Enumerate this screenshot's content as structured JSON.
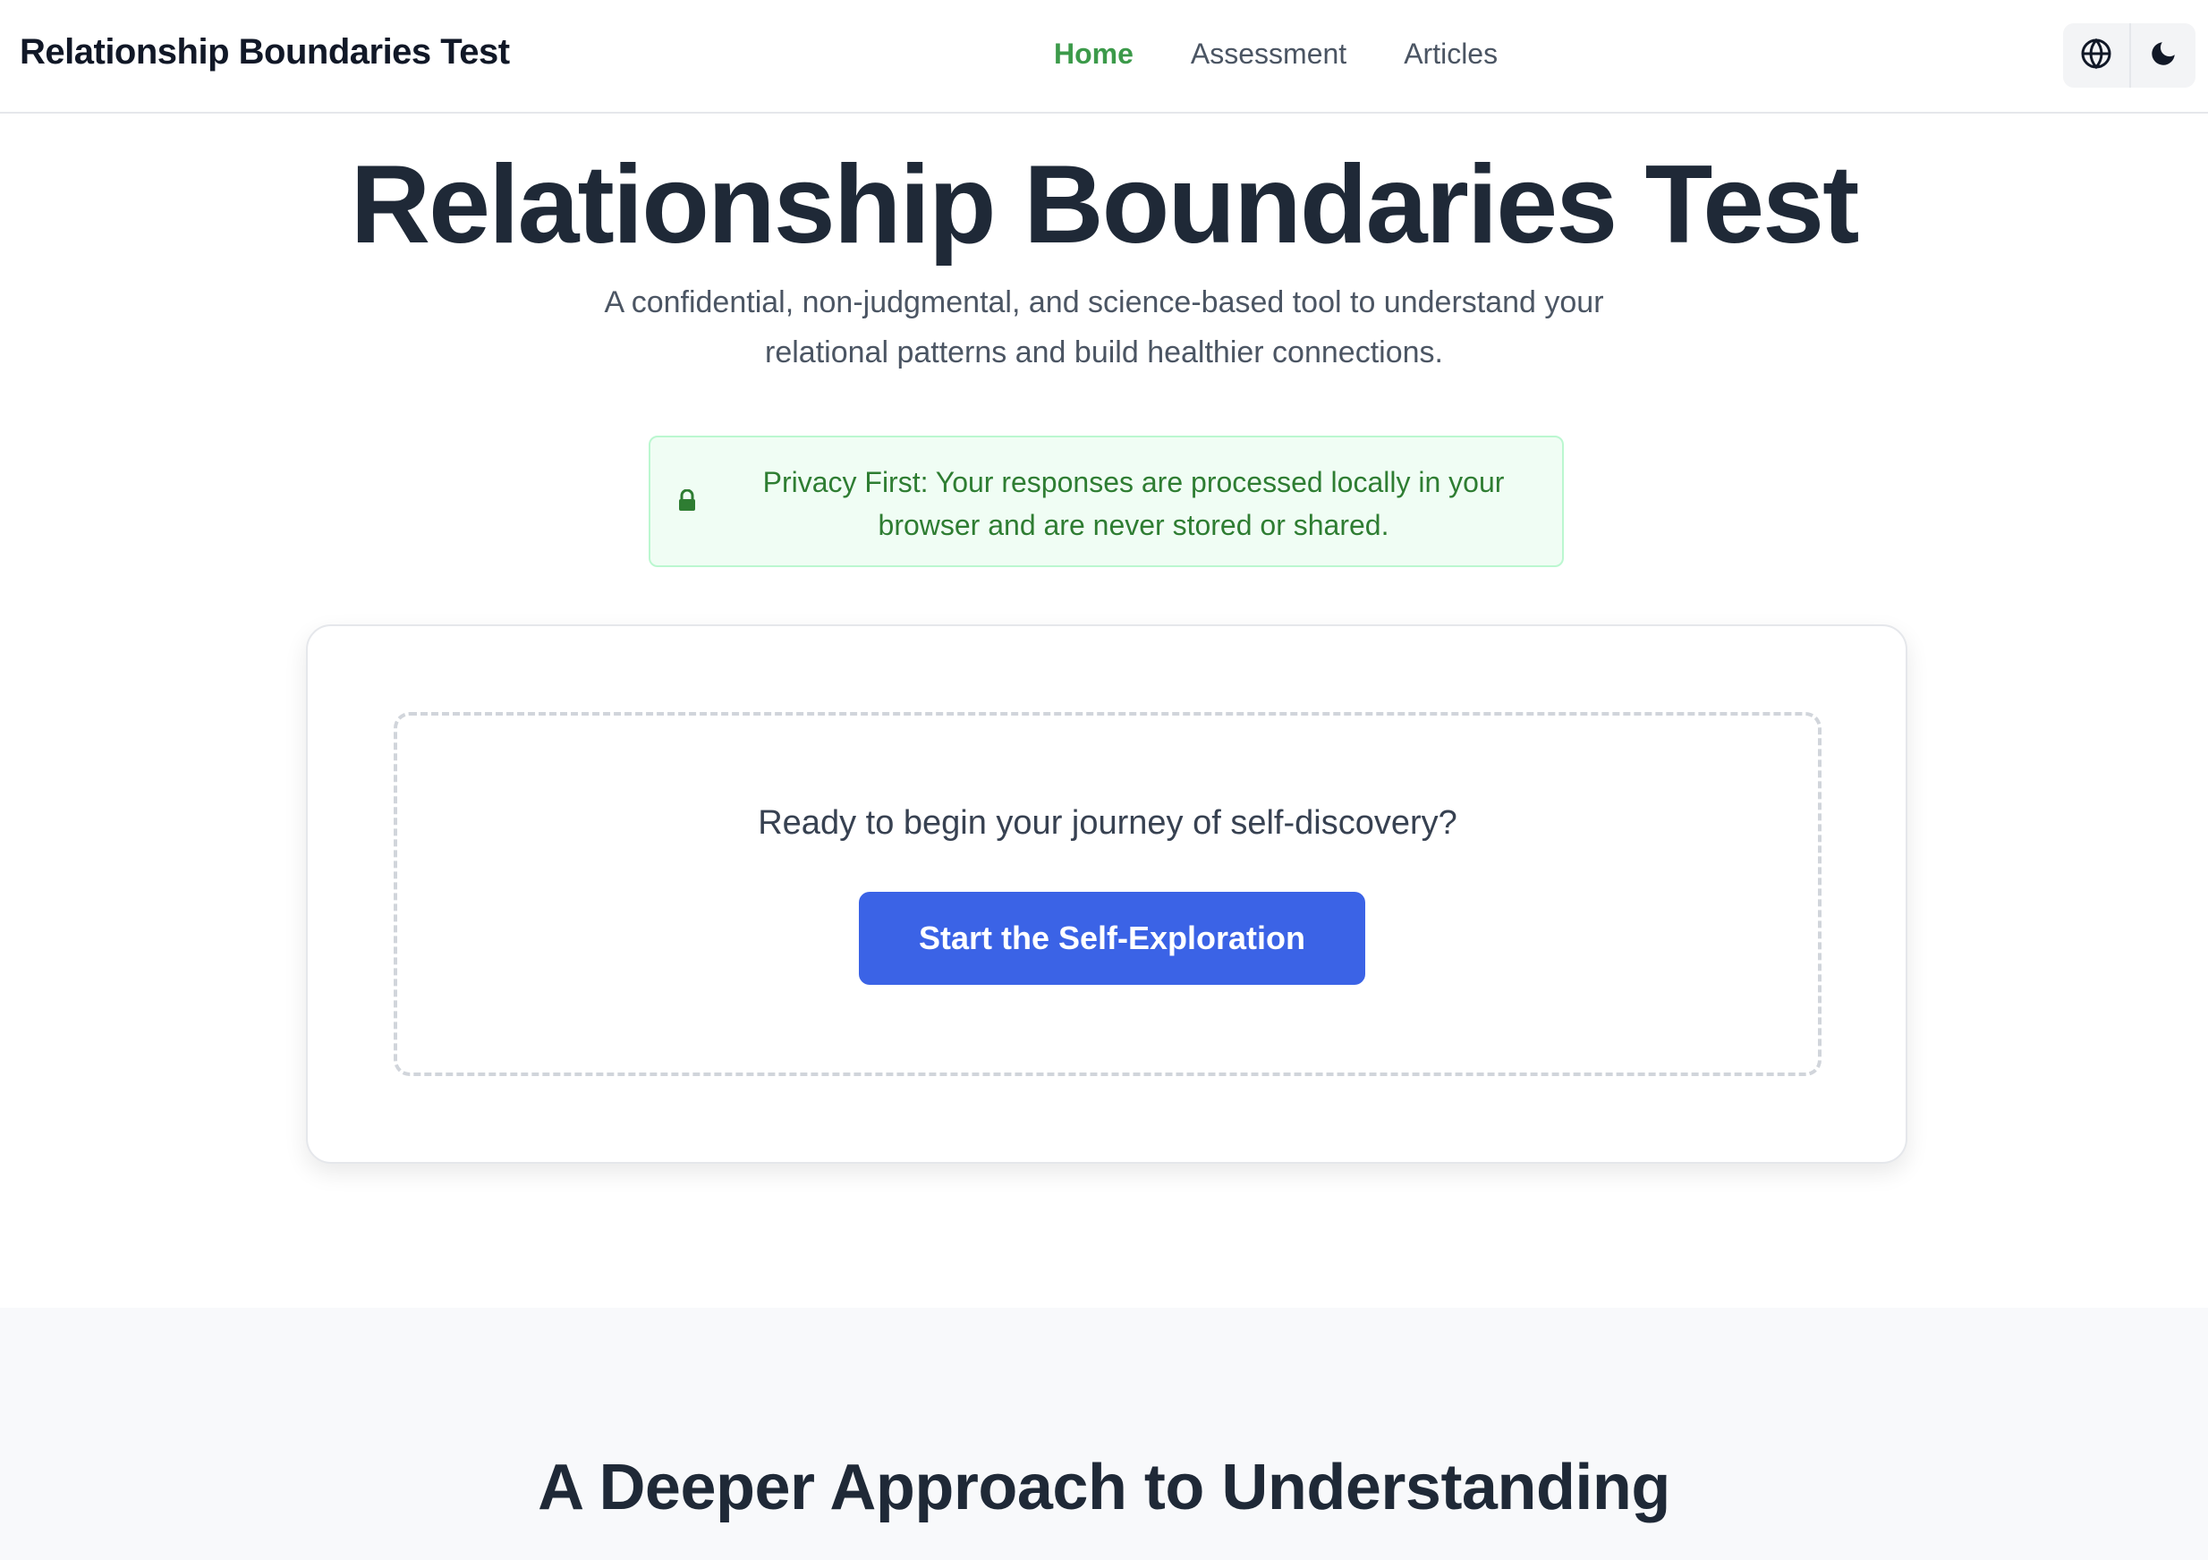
{
  "header": {
    "brand": "Relationship Boundaries Test",
    "nav": [
      {
        "label": "Home",
        "active": true
      },
      {
        "label": "Assessment",
        "active": false
      },
      {
        "label": "Articles",
        "active": false
      }
    ],
    "tools": [
      {
        "icon": "globe-icon"
      },
      {
        "icon": "moon-icon"
      }
    ]
  },
  "hero": {
    "title": "Relationship Boundaries Test",
    "subtitle": "A confidential, non-judgmental, and science-based tool to understand your relational patterns and build healthier connections."
  },
  "privacy": {
    "icon": "lock-icon",
    "text": "Privacy First: Your responses are processed locally in your browser and are never stored or shared."
  },
  "start_card": {
    "prompt": "Ready to begin your journey of self-discovery?",
    "button_label": "Start the Self-Exploration"
  },
  "section": {
    "title": "A Deeper Approach to Understanding"
  },
  "colors": {
    "accent_green": "#3c9a4a",
    "primary_button": "#3b63e6",
    "privacy_bg": "#f0fdf4",
    "privacy_text": "#2e7d32",
    "heading": "#1f2937"
  }
}
